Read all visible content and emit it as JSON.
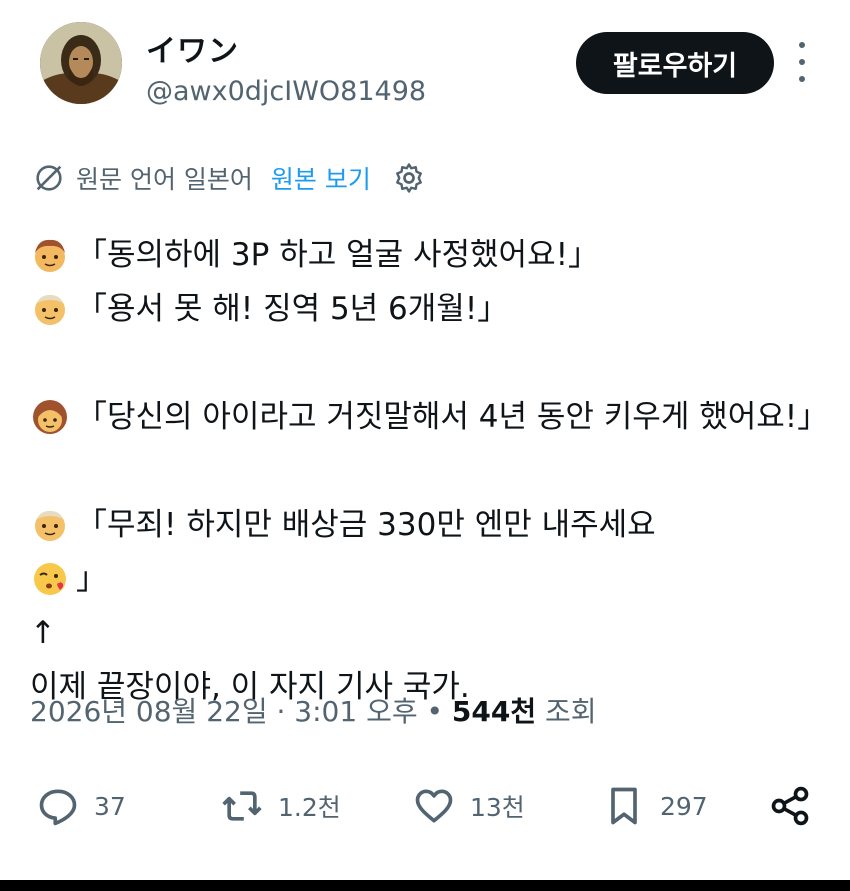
{
  "user": {
    "display_name": "イワン",
    "handle": "@awx0djcIWO81498"
  },
  "follow_label": "팔로우하기",
  "translation": {
    "source_language": "원문 언어 일본어",
    "show_original": "원본 보기"
  },
  "post": {
    "lines": [
      "「동의하에 3P 하고 얼굴 사정했어요!」",
      "「용서 못 해! 징역 5년 6개월!」",
      "「당신의 아이라고 거짓말해서 4년 동안 키우게 했어요!」",
      "「무죄! 하지만 배상금 330만 엔만 내주세요",
      "」",
      "↑",
      "이제 끝장이야, 이 자지 기사 국가."
    ]
  },
  "meta": {
    "timestamp": "2026년 08월 22일 · 3:01 오후 •",
    "views_count": "544천",
    "views_label": "조회"
  },
  "actions": {
    "replies": "37",
    "reposts": "1.2천",
    "likes": "13천",
    "bookmarks": "297"
  },
  "icons": {
    "more": "more-vertical-icon",
    "translate": "globe-slash-icon",
    "settings": "gear-icon",
    "reply": "reply-icon",
    "repost": "repost-icon",
    "like": "heart-icon",
    "bookmark": "bookmark-icon",
    "share": "share-icon"
  },
  "colors": {
    "text": "#0f1419",
    "secondary": "#536471",
    "link": "#1d9bf0",
    "button_bg": "#0f1419"
  }
}
